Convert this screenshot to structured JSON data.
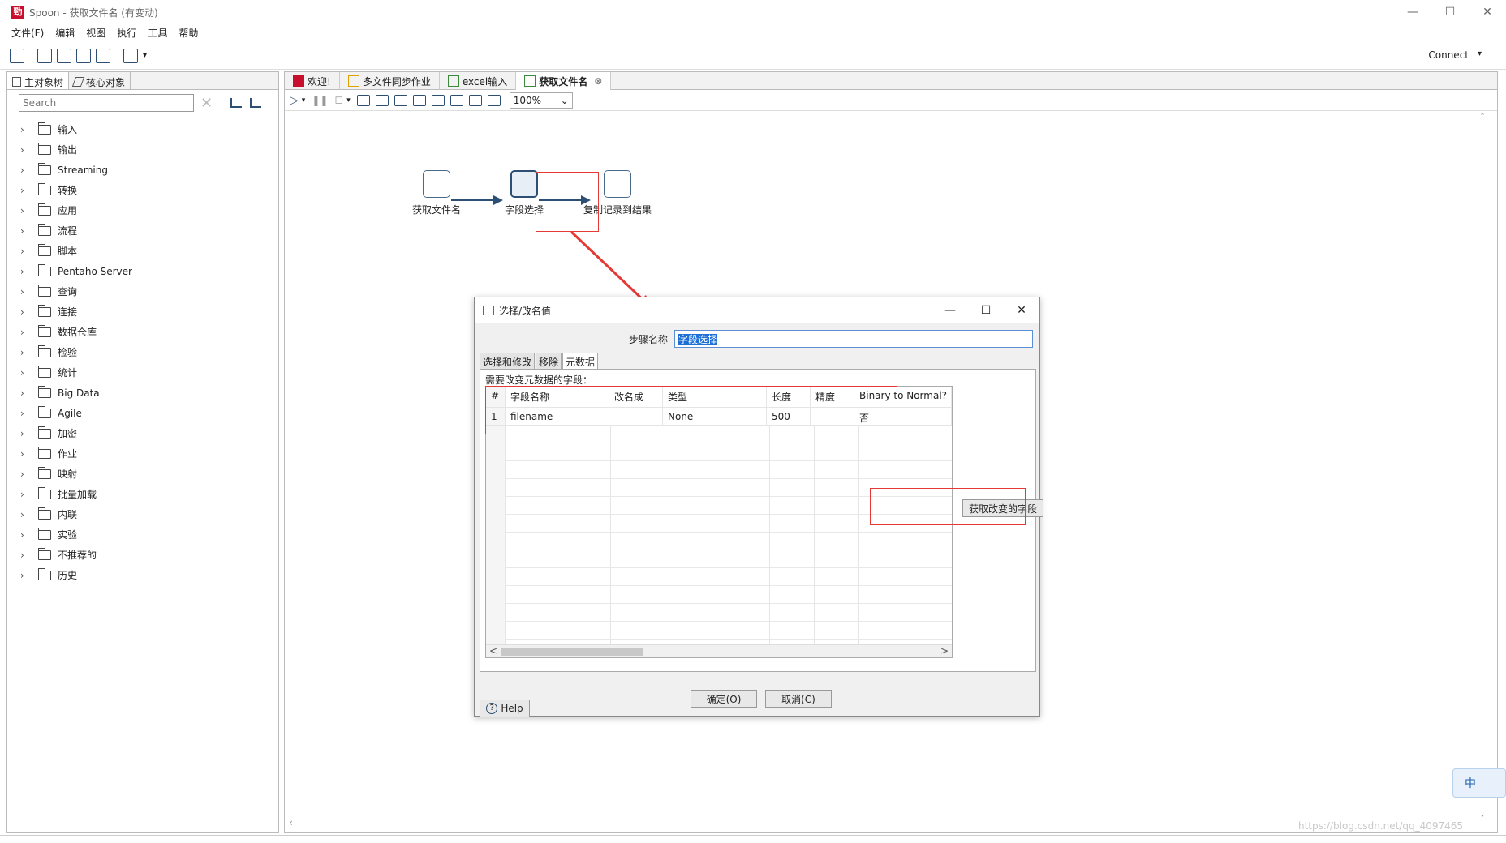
{
  "window": {
    "title": "Spoon - 获取文件名 (有变动)",
    "app_icon_glyph": "勁"
  },
  "menu": [
    "文件(F)",
    "编辑",
    "视图",
    "执行",
    "工具",
    "帮助"
  ],
  "toolbar": {
    "connect_label": "Connect"
  },
  "left_panel": {
    "tabs": [
      "主对象树",
      "核心对象"
    ],
    "search_placeholder": "Search",
    "tree_items": [
      "输入",
      "输出",
      "Streaming",
      "转换",
      "应用",
      "流程",
      "脚本",
      "Pentaho Server",
      "查询",
      "连接",
      "数据仓库",
      "检验",
      "统计",
      "Big Data",
      "Agile",
      "加密",
      "作业",
      "映射",
      "批量加载",
      "内联",
      "实验",
      "不推荐的",
      "历史"
    ]
  },
  "doc_tabs": [
    {
      "label": "欢迎!",
      "active": false
    },
    {
      "label": "多文件同步作业",
      "active": false
    },
    {
      "label": "excel输入",
      "active": false
    },
    {
      "label": "获取文件名",
      "active": true
    }
  ],
  "canvas_toolbar": {
    "zoom": "100%"
  },
  "canvas": {
    "steps": [
      {
        "label": "获取文件名"
      },
      {
        "label": "字段选择"
      },
      {
        "label": "复制记录到结果"
      }
    ]
  },
  "dialog": {
    "title": "选择/改名值",
    "step_name_label": "步骤名称",
    "step_name_value": "字段选择",
    "tabs": [
      "选择和修改",
      "移除",
      "元数据"
    ],
    "active_tab": "元数据",
    "section_label": "需要改变元数据的字段：",
    "columns": [
      "#",
      "字段名称",
      "改名成",
      "类型",
      "长度",
      "精度",
      "Binary to Normal?"
    ],
    "rows": [
      [
        "1",
        "filename",
        "",
        "None",
        "500",
        "",
        "否"
      ]
    ],
    "get_fields_button": "获取改变的字段",
    "ok_button": "确定(O)",
    "cancel_button": "取消(C)",
    "help_button": "Help"
  },
  "ime": {
    "label": "中"
  },
  "watermark": "https://blog.csdn.net/qq_4097465"
}
